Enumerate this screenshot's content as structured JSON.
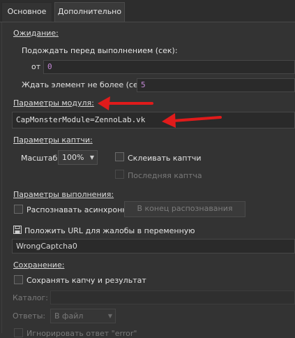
{
  "tabs": [
    {
      "label": "Основное"
    },
    {
      "label": "Дополнительно"
    }
  ],
  "waiting": {
    "title": "Ожидание:",
    "delay_label": "Подождать перед выполнением (сек):",
    "from_label": "от",
    "from_value": "0",
    "wait_element_label": "Ждать элемент не более (сек):",
    "wait_element_value": "5"
  },
  "module": {
    "title": "Параметры модуля:",
    "value": "CapMonsterModule=ZennoLab.vk"
  },
  "captcha": {
    "title": "Параметры каптчи:",
    "scale_label": "Масштаб",
    "scale_value": "100%",
    "glue_label": "Склеивать каптчи",
    "last_label": "Последняя каптча"
  },
  "execution": {
    "title": "Параметры выполнения:",
    "async_label": "Распознавать асинхронно",
    "end_button": "В конец распознавания"
  },
  "complaint": {
    "label": "Положить URL для жалобы в переменную",
    "value": "WrongCaptcha0"
  },
  "saving": {
    "title": "Сохранение:",
    "save_label": "Сохранять капчу и результат",
    "catalog_label": "Каталог:",
    "answers_label": "Ответы:",
    "answers_value": "В файл",
    "ignore_label": "Игнорировать ответ \"error\""
  },
  "colors": {
    "background": "#333333",
    "arrow": "#e01b1b",
    "number": "#c58ad8"
  }
}
